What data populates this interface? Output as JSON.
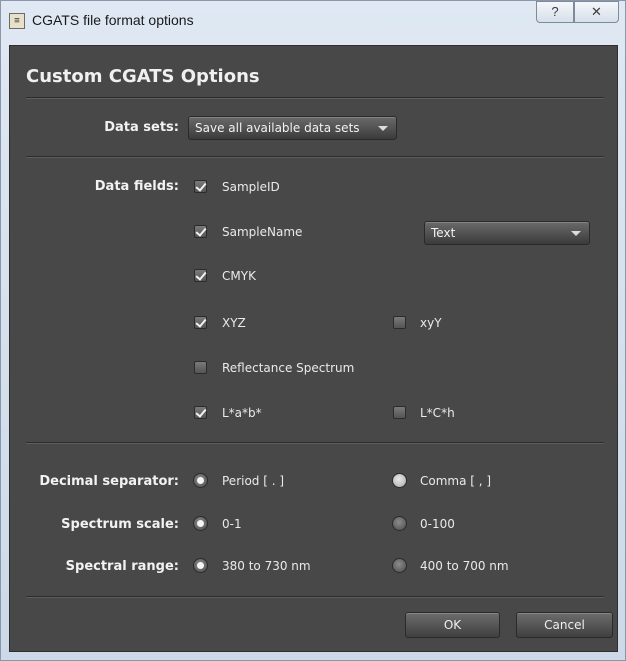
{
  "window": {
    "title": "CGATS file format options",
    "help_label": "?",
    "close_label": "✕",
    "app_icon": "cgats-app-icon"
  },
  "panel": {
    "heading": "Custom CGATS Options"
  },
  "data_sets": {
    "label": "Data sets:",
    "selected": "Save all available data sets"
  },
  "data_fields": {
    "label": "Data fields:",
    "sample_id": {
      "label": "SampleID",
      "checked": true
    },
    "sample_name": {
      "label": "SampleName",
      "checked": true,
      "type_selected": "Text"
    },
    "cmyk": {
      "label": "CMYK",
      "checked": true
    },
    "xyz": {
      "label": "XYZ",
      "checked": true
    },
    "xyY": {
      "label": "xyY",
      "checked": false
    },
    "reflectance": {
      "label": "Reflectance Spectrum",
      "checked": false
    },
    "lab": {
      "label": "L*a*b*",
      "checked": true
    },
    "lch": {
      "label": "L*C*h",
      "checked": false
    }
  },
  "decimal_separator": {
    "label": "Decimal separator:",
    "option1": "Period [ . ]",
    "option2": "Comma [ , ]",
    "selected": "Period [ . ]"
  },
  "spectrum_scale": {
    "label": "Spectrum scale:",
    "option1": "0-1",
    "option2": "0-100"
  },
  "spectral_range": {
    "label": "Spectral range:",
    "option1": "380 to 730 nm",
    "option2": "400 to 700 nm"
  },
  "buttons": {
    "ok": "OK",
    "cancel": "Cancel"
  }
}
